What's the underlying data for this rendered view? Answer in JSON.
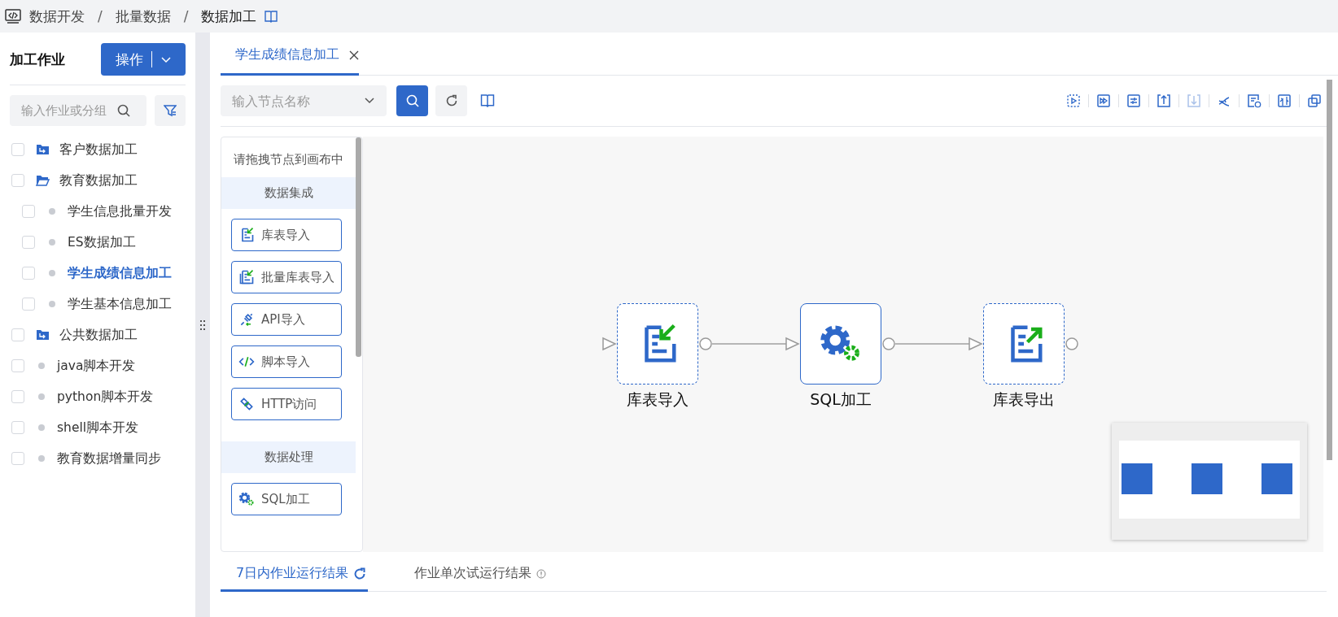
{
  "breadcrumb": [
    {
      "kind": "link",
      "label": "数据开发"
    },
    {
      "kind": "separator",
      "label": "/"
    },
    {
      "kind": "link",
      "label": "批量数据"
    },
    {
      "kind": "separator",
      "label": "/"
    },
    {
      "kind": "current",
      "label": "数据加工"
    }
  ],
  "sidebar": {
    "title": "加工作业",
    "action_button": "操作",
    "search": {
      "placeholder": "输入作业或分组"
    },
    "tree": [
      {
        "kind": "folder",
        "label": "客户数据加工",
        "checked": false,
        "selected": false,
        "expanded": false
      },
      {
        "kind": "folder",
        "label": "教育数据加工",
        "checked": false,
        "selected": false,
        "expanded": true,
        "children": [
          {
            "kind": "job",
            "label": "学生信息批量开发",
            "checked": false,
            "selected": false
          },
          {
            "kind": "job",
            "label": "ES数据加工",
            "checked": false,
            "selected": false
          },
          {
            "kind": "job",
            "label": "学生成绩信息加工",
            "checked": false,
            "selected": true
          },
          {
            "kind": "job",
            "label": "学生基本信息加工",
            "checked": false,
            "selected": false
          }
        ]
      },
      {
        "kind": "folder",
        "label": "公共数据加工",
        "checked": false,
        "selected": false,
        "expanded": false
      },
      {
        "kind": "job",
        "label": "java脚本开发",
        "checked": false,
        "selected": false
      },
      {
        "kind": "job",
        "label": "python脚本开发",
        "checked": false,
        "selected": false
      },
      {
        "kind": "job",
        "label": "shell脚本开发",
        "checked": false,
        "selected": false
      },
      {
        "kind": "job",
        "label": "教育数据增量同步",
        "checked": false,
        "selected": false
      }
    ]
  },
  "tabs": [
    {
      "label": "学生成绩信息加工",
      "selected": true
    }
  ],
  "toolbar": {
    "node_search": {
      "placeholder": "输入节点名称"
    },
    "icons": [
      {
        "kind": "run-selected",
        "disabled": false
      },
      {
        "kind": "run-from",
        "disabled": false
      },
      {
        "kind": "settings",
        "disabled": false
      },
      {
        "kind": "upload",
        "disabled": false
      },
      {
        "kind": "download",
        "disabled": true
      },
      {
        "kind": "dna",
        "disabled": false
      },
      {
        "kind": "schedule",
        "disabled": false
      },
      {
        "kind": "supplement",
        "disabled": false
      },
      {
        "kind": "copy",
        "disabled": false
      }
    ]
  },
  "palette": {
    "hint": "请拖拽节点到画布中",
    "groups": [
      {
        "title": "数据集成",
        "items": [
          {
            "kind": "table-import",
            "label": "库表导入"
          },
          {
            "kind": "batch-import",
            "label": "批量库表导入"
          },
          {
            "kind": "api-import",
            "label": "API导入"
          },
          {
            "kind": "script-import",
            "label": "脚本导入"
          },
          {
            "kind": "http",
            "label": "HTTP访问"
          }
        ]
      },
      {
        "title": "数据处理",
        "items": [
          {
            "kind": "sql",
            "label": "SQL加工"
          }
        ]
      }
    ]
  },
  "canvas": {
    "nodes": [
      {
        "kind": "table-import",
        "label": "库表导入",
        "selected": false
      },
      {
        "kind": "sql",
        "label": "SQL加工",
        "selected": true
      },
      {
        "kind": "table-export",
        "label": "库表导出",
        "selected": false
      }
    ]
  },
  "result_tabs": [
    {
      "label": "7日内作业运行结果",
      "selected": true,
      "kind": "refresh"
    },
    {
      "label": "作业单次试运行结果",
      "selected": false,
      "kind": "info"
    }
  ]
}
